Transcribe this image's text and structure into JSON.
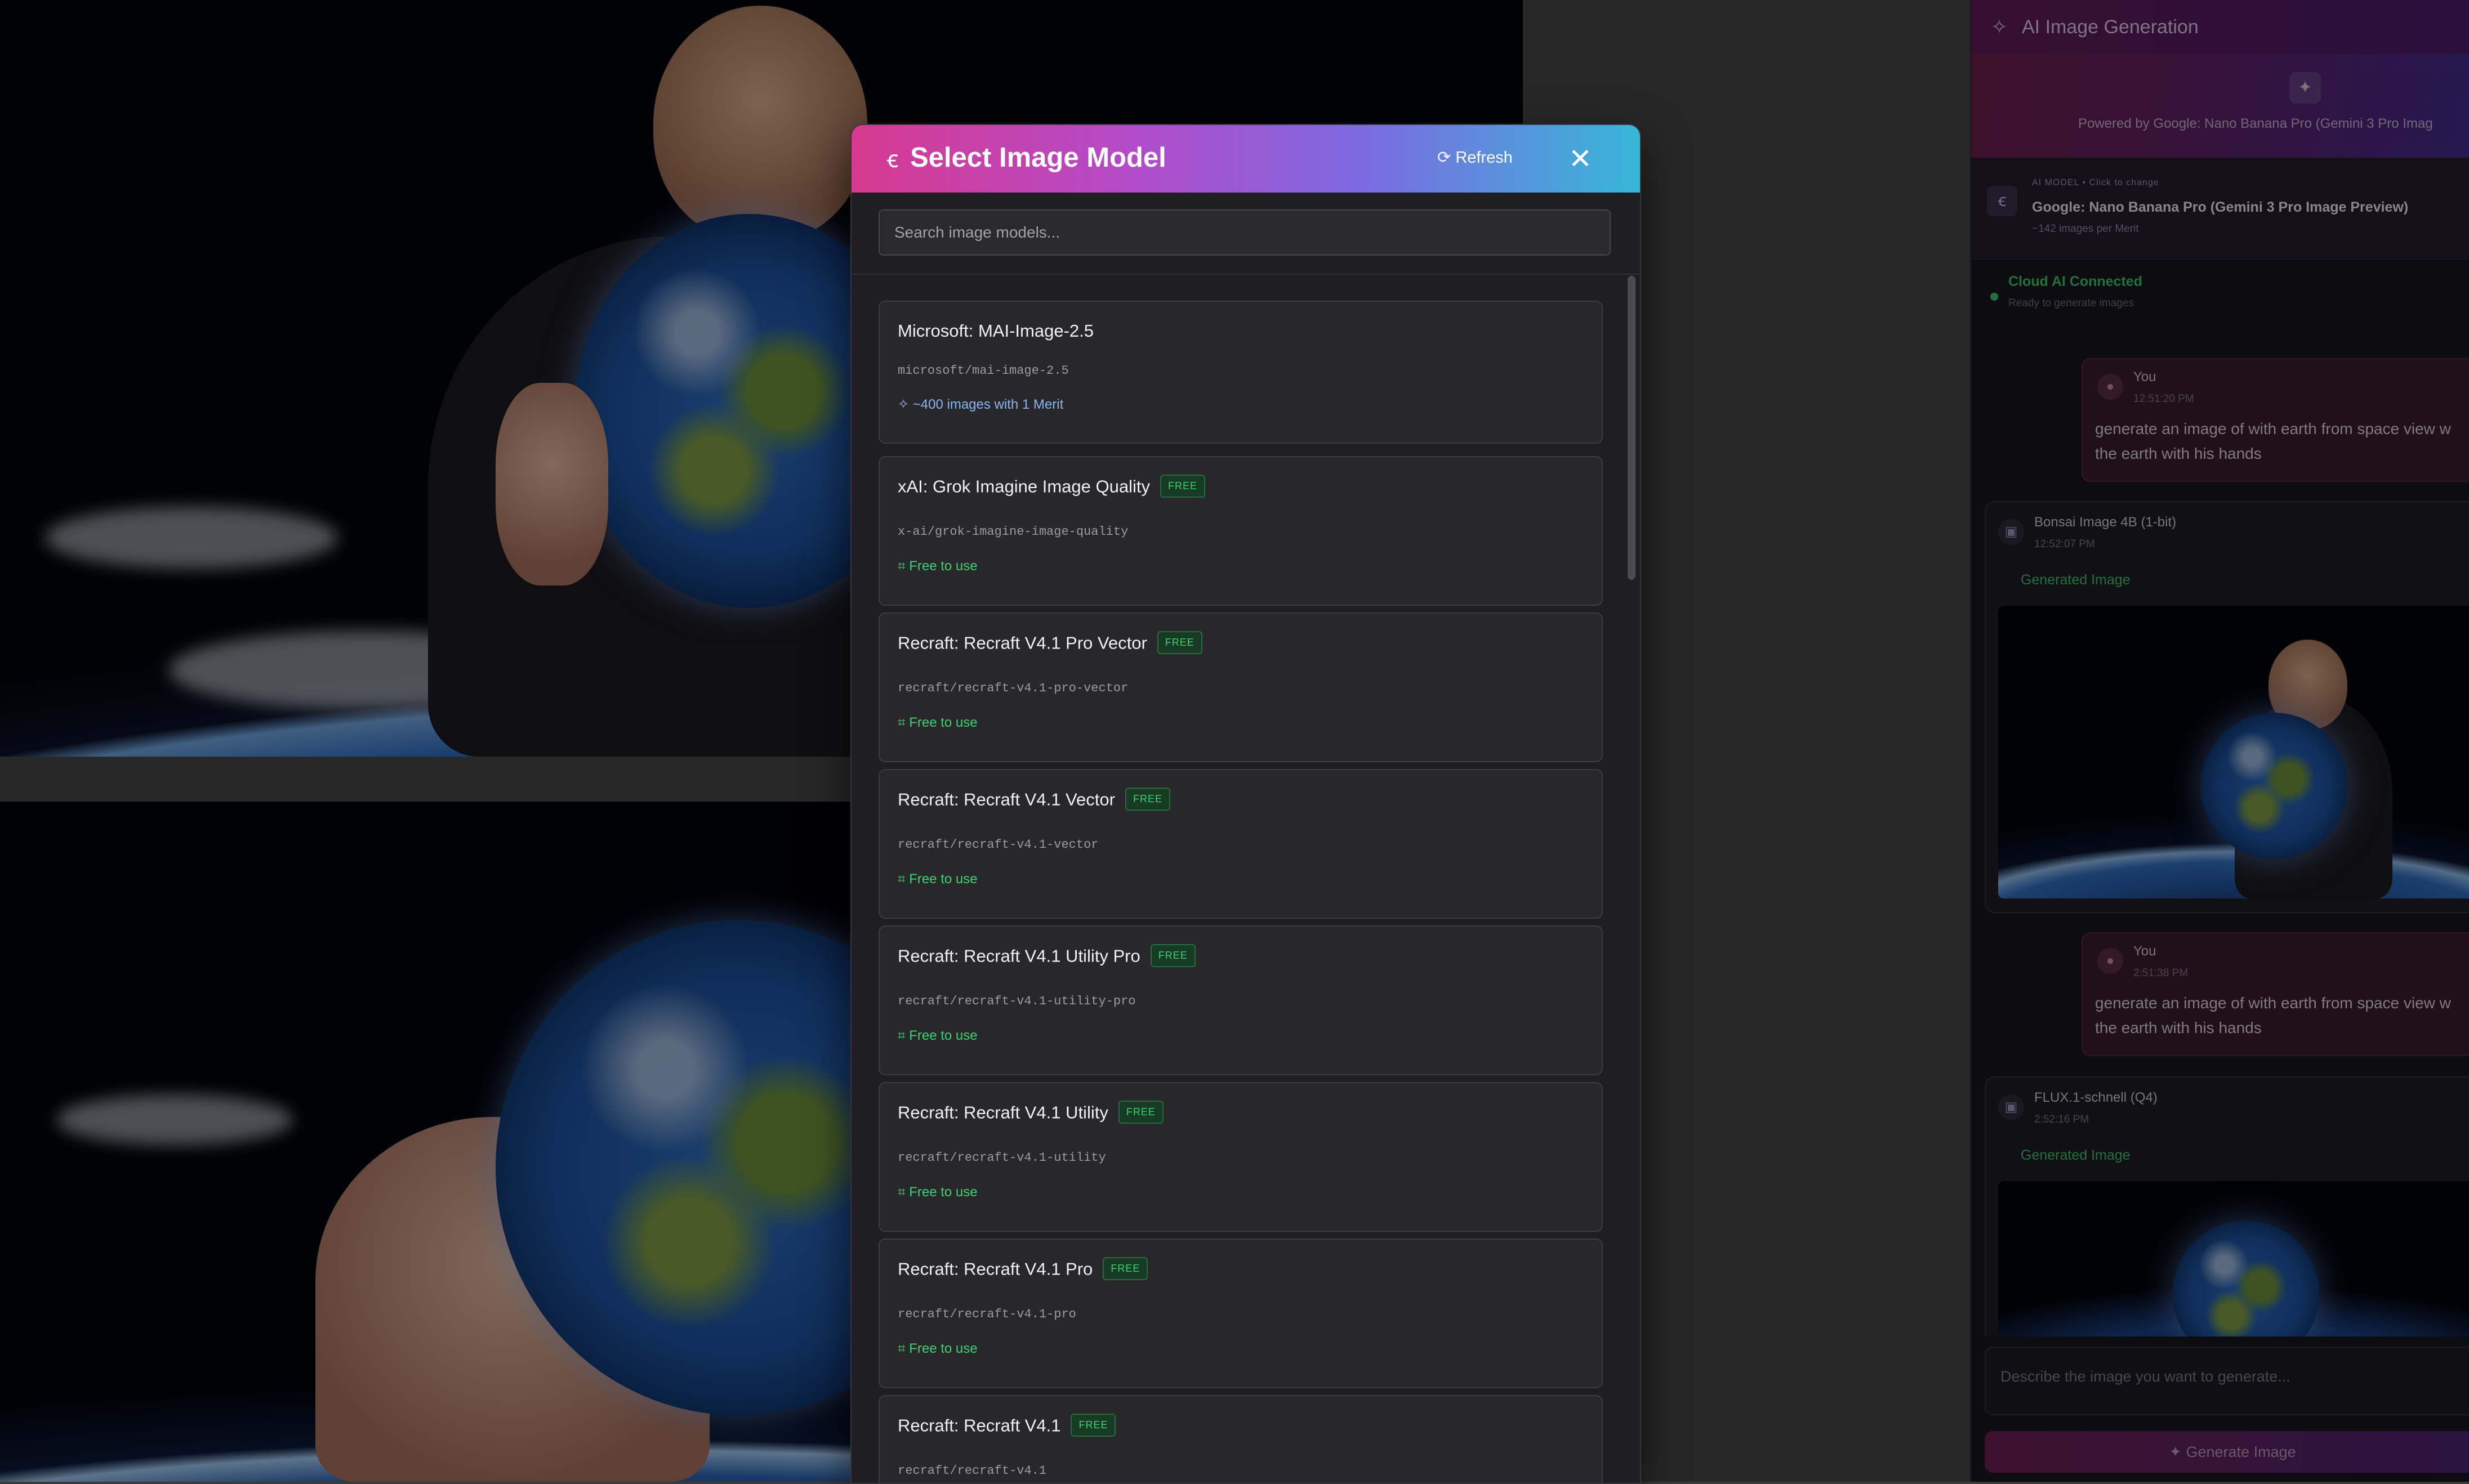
{
  "modal": {
    "title": "Select Image Model",
    "refresh_label": "Refresh",
    "close_symbol": "✕",
    "search_placeholder": "Search image models...",
    "models": [
      {
        "name": "Microsoft: MAI-Image-2.5",
        "slug": "microsoft/mai-image-2.5",
        "badge": "",
        "footer": "~400 images with 1 Merit",
        "footer_type": "merit"
      },
      {
        "name": "xAI: Grok Imagine Image Quality",
        "slug": "x-ai/grok-imagine-image-quality",
        "badge": "FREE",
        "footer": "Free to use",
        "footer_type": "free"
      },
      {
        "name": "Recraft: Recraft V4.1 Pro Vector",
        "slug": "recraft/recraft-v4.1-pro-vector",
        "badge": "FREE",
        "footer": "Free to use",
        "footer_type": "free"
      },
      {
        "name": "Recraft: Recraft V4.1 Vector",
        "slug": "recraft/recraft-v4.1-vector",
        "badge": "FREE",
        "footer": "Free to use",
        "footer_type": "free"
      },
      {
        "name": "Recraft: Recraft V4.1 Utility Pro",
        "slug": "recraft/recraft-v4.1-utility-pro",
        "badge": "FREE",
        "footer": "Free to use",
        "footer_type": "free"
      },
      {
        "name": "Recraft: Recraft V4.1 Utility",
        "slug": "recraft/recraft-v4.1-utility",
        "badge": "FREE",
        "footer": "Free to use",
        "footer_type": "free"
      },
      {
        "name": "Recraft: Recraft V4.1 Pro",
        "slug": "recraft/recraft-v4.1-pro",
        "badge": "FREE",
        "footer": "Free to use",
        "footer_type": "free"
      },
      {
        "name": "Recraft: Recraft V4.1",
        "slug": "recraft/recraft-v4.1",
        "badge": "FREE",
        "footer": "",
        "footer_type": "free"
      }
    ]
  },
  "panel": {
    "title": "AI Image Generation",
    "powered_by": "Powered by  Google: Nano Banana Pro (Gemini 3 Pro Imag",
    "model_label": "AI MODEL  •  Click to change",
    "model_name": "Google: Nano Banana Pro (Gemini 3 Pro Image Preview)",
    "model_sub": "~142 images per Merit",
    "status_title": "Cloud AI Connected",
    "status_sub": "Ready to generate images",
    "messages": [
      {
        "role": "user",
        "who": "You",
        "time": "12:51:20 PM",
        "line1": "generate an image of with earth from space view w",
        "line2": "the earth with his hands"
      },
      {
        "role": "bot",
        "who": "Bonsai Image 4B (1-bit)",
        "time": "12:52:07 PM",
        "label": "Generated Image"
      },
      {
        "role": "user",
        "who": "You",
        "time": "2:51:38 PM",
        "line1": "generate an image of with earth from space view w",
        "line2": "the earth with his hands"
      },
      {
        "role": "bot",
        "who": "FLUX.1-schnell (Q4)",
        "time": "2:52:16 PM",
        "label": "Generated Image"
      }
    ],
    "input_placeholder": "Describe the image you want to generate...",
    "generate_label": "Generate Image"
  },
  "colors": {
    "accent_green": "#42cf72",
    "header_gradient_start": "#d63a8f",
    "header_gradient_end": "#37b7d8",
    "merit_blue": "#8ab4ef"
  },
  "icons": {
    "modal_title": "image-model-icon",
    "refresh": "refresh-icon",
    "close": "close-icon",
    "merit": "sparkle-icon",
    "free": "gift-icon"
  }
}
